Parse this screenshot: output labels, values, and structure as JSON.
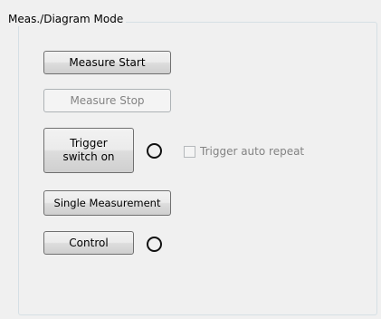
{
  "group": {
    "title": "Meas./Diagram Mode"
  },
  "buttons": {
    "measure_start": "Measure Start",
    "measure_stop": "Measure Stop",
    "trigger_line1": "Trigger",
    "trigger_line2": "switch on",
    "single_measurement": "Single Measurement",
    "control": "Control"
  },
  "trigger_auto_repeat": {
    "label": "Trigger auto repeat",
    "checked": false,
    "enabled": false
  },
  "indicators": {
    "trigger_led_on": false,
    "control_led_on": false
  }
}
